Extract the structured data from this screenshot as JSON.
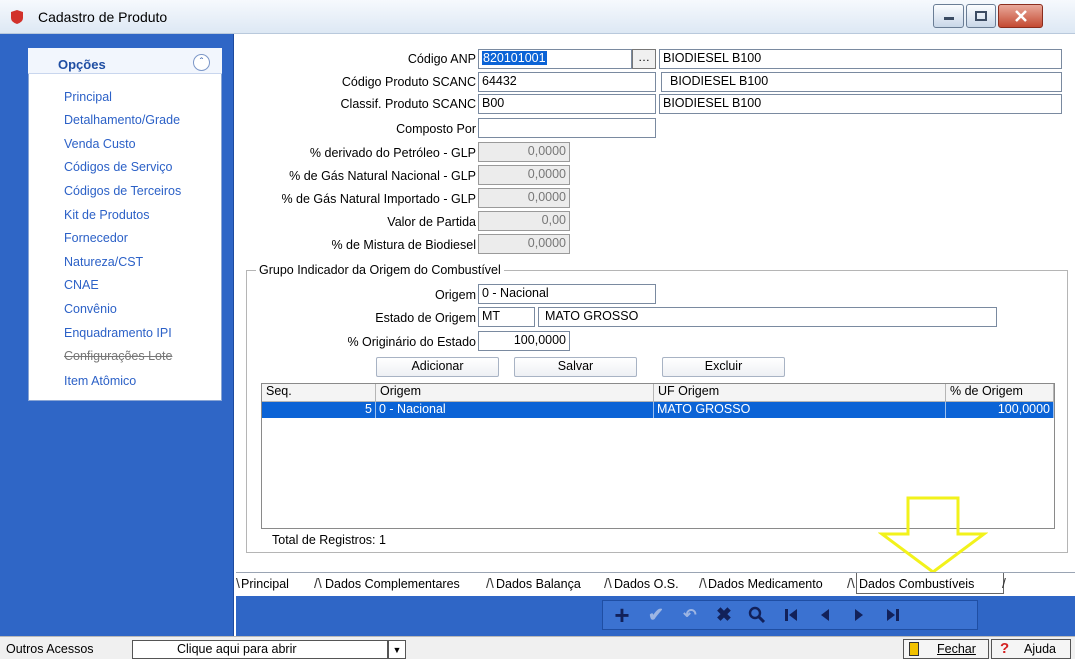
{
  "window": {
    "title": "Cadastro de Produto"
  },
  "sidebar": {
    "title": "Opções",
    "items": [
      {
        "label": "Principal"
      },
      {
        "label": "Detalhamento/Grade"
      },
      {
        "label": "Venda Custo"
      },
      {
        "label": "Códigos de Serviço"
      },
      {
        "label": "Códigos de Terceiros"
      },
      {
        "label": "Kit de Produtos"
      },
      {
        "label": "Fornecedor"
      },
      {
        "label": "Natureza/CST"
      },
      {
        "label": "CNAE"
      },
      {
        "label": "Convênio"
      },
      {
        "label": "Enquadramento IPI"
      },
      {
        "label": "Configurações Lote"
      },
      {
        "label": "Item Atômico"
      }
    ]
  },
  "form": {
    "codigo_anp": {
      "label": "Código ANP",
      "value": "820101001",
      "desc": "BIODIESEL B100"
    },
    "codigo_scanc": {
      "label": "Código Produto SCANC",
      "value": "64432",
      "desc": "BIODIESEL B100"
    },
    "classif_scanc": {
      "label": "Classif. Produto SCANC",
      "value": "B00",
      "desc": "BIODIESEL B100"
    },
    "composto_por": {
      "label": "Composto Por",
      "value": ""
    },
    "derivado_petroleo": {
      "label": "% derivado do Petróleo - GLP",
      "value": "0,0000"
    },
    "gas_nacional": {
      "label": "% de Gás Natural Nacional - GLP",
      "value": "0,0000"
    },
    "gas_importado": {
      "label": "% de Gás Natural Importado - GLP",
      "value": "0,0000"
    },
    "valor_partida": {
      "label": "Valor de Partida",
      "value": "0,00"
    },
    "mistura_biodiesel": {
      "label": "% de Mistura de Biodiesel",
      "value": "0,0000"
    }
  },
  "grupo": {
    "title": "Grupo Indicador da Origem do Combustível",
    "origem": {
      "label": "Origem",
      "value": "0 - Nacional"
    },
    "estado": {
      "label": "Estado de Origem",
      "uf": "MT",
      "nome": "MATO GROSSO"
    },
    "originario": {
      "label": "% Originário do Estado",
      "value": "100,0000"
    },
    "buttons": {
      "adicionar": "Adicionar",
      "salvar": "Salvar",
      "excluir": "Excluir"
    },
    "grid": {
      "headers": [
        "Seq.",
        "Origem",
        "UF Origem",
        "% de Origem"
      ],
      "rows": [
        [
          "5",
          "0 - Nacional",
          "MATO GROSSO",
          "100,0000"
        ]
      ]
    },
    "total": "Total de Registros: 1"
  },
  "tabs": [
    "Principal",
    "Dados Complementares",
    "Dados Balança",
    "Dados O.S.",
    "Dados Medicamento",
    "Dados Combustíveis"
  ],
  "statusbar": {
    "outros": "Outros Acessos",
    "abrir": "Clique aqui para abrir",
    "fechar": "Fechar",
    "ajuda": "Ajuda"
  },
  "colors": {
    "sidebar_bg": "#2f66c6",
    "selection": "#0b63d6",
    "arrow": "#f2f21b"
  },
  "icons": [
    "add-icon",
    "confirm-icon",
    "undo-icon",
    "delete-icon",
    "search-icon",
    "first-icon",
    "prev-icon",
    "next-icon",
    "last-icon"
  ]
}
